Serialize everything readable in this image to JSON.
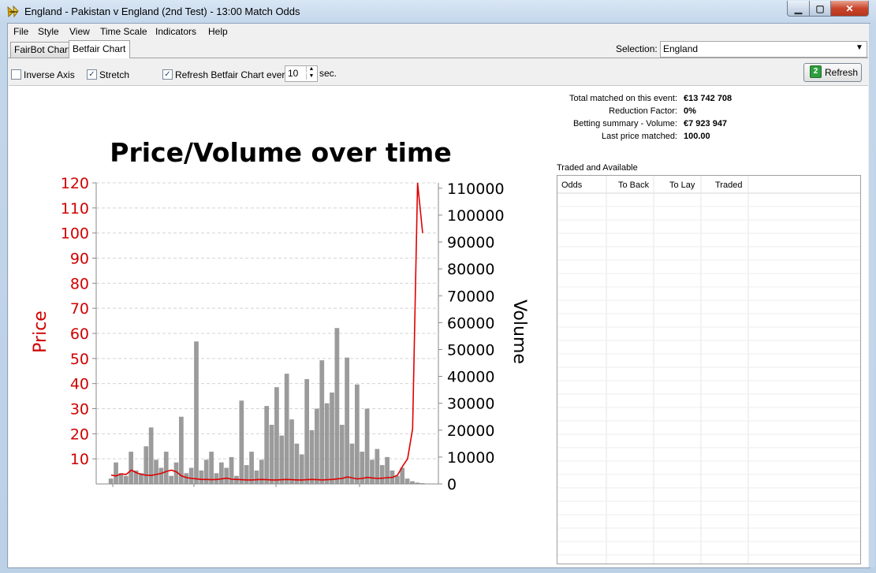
{
  "window": {
    "title": "England - Pakistan v England (2nd Test) - 13:00 Match Odds"
  },
  "menu": [
    "File",
    "Style",
    "View",
    "Time Scale",
    "Indicators",
    "Help"
  ],
  "tabs": [
    {
      "label": "FairBot Chart",
      "active": false
    },
    {
      "label": "Betfair Chart",
      "active": true
    }
  ],
  "selection": {
    "label": "Selection:",
    "value": "England"
  },
  "toolbar": {
    "inverse_axis": {
      "label": "Inverse Axis",
      "checked": false
    },
    "stretch": {
      "label": "Stretch",
      "checked": true
    },
    "refresh_every": {
      "label": "Refresh Betfair Chart every",
      "checked": true
    },
    "interval_value": "10",
    "interval_unit": "sec.",
    "refresh_button": "Refresh"
  },
  "summary": [
    {
      "label": "Total matched on this event:",
      "value": "€13 742 708"
    },
    {
      "label": "Reduction Factor:",
      "value": "0%"
    },
    {
      "label": "Betting summary - Volume:",
      "value": "€7 923 947"
    },
    {
      "label": "Last price matched:",
      "value": "100.00"
    }
  ],
  "traded": {
    "title": "Traded and Available",
    "columns": [
      "Odds",
      "To Back",
      "To Lay",
      "Traded"
    ],
    "rows": []
  },
  "colors": {
    "price": "#e00000",
    "volume": "#8a8a8a"
  },
  "chart_data": {
    "type": "line",
    "title": "Price/Volume over time",
    "ylabel_left": "Price",
    "ylabel_right": "Volume",
    "y_left_ticks": [
      10,
      20,
      30,
      40,
      50,
      60,
      70,
      80,
      90,
      100,
      110,
      120
    ],
    "y_right_ticks": [
      0,
      10000,
      20000,
      30000,
      40000,
      50000,
      60000,
      70000,
      80000,
      90000,
      100000,
      110000
    ],
    "ylim_left": [
      0,
      120
    ],
    "ylim_right": [
      0,
      112000
    ],
    "grid": true,
    "series": [
      {
        "name": "Price",
        "axis": "left",
        "values": [
          3.5,
          3.2,
          4.0,
          3.8,
          5.5,
          4.5,
          3.8,
          3.5,
          3.4,
          3.8,
          4.2,
          5.0,
          5.5,
          4.8,
          3.2,
          2.5,
          2.2,
          2.0,
          1.8,
          1.8,
          1.7,
          1.8,
          2.0,
          2.3,
          1.9,
          1.8,
          1.7,
          1.6,
          1.6,
          1.7,
          1.8,
          1.7,
          1.6,
          1.6,
          1.7,
          1.8,
          1.7,
          1.6,
          1.6,
          1.7,
          1.8,
          1.7,
          1.6,
          1.7,
          1.8,
          2.0,
          2.2,
          2.8,
          2.4,
          2.0,
          2.2,
          2.6,
          2.4,
          2.2,
          2.3,
          2.5,
          2.6,
          3.5,
          7.0,
          10.0,
          22.0,
          120.0,
          100.0
        ]
      },
      {
        "name": "Volume",
        "axis": "right",
        "values": [
          2000,
          8000,
          4000,
          3000,
          12000,
          5000,
          4000,
          14000,
          21000,
          9000,
          6000,
          12000,
          3000,
          8000,
          25000,
          4000,
          6000,
          53000,
          5000,
          9000,
          12000,
          4000,
          8000,
          6000,
          10000,
          3000,
          31000,
          7000,
          12000,
          5000,
          9000,
          29000,
          22000,
          36000,
          18000,
          41000,
          24000,
          15000,
          11000,
          39000,
          20000,
          28000,
          46000,
          30000,
          34000,
          58000,
          22000,
          47000,
          15000,
          37000,
          12000,
          28000,
          9000,
          13000,
          7000,
          10000,
          5000,
          3000,
          6000,
          2000,
          1000,
          500,
          300
        ]
      }
    ]
  }
}
